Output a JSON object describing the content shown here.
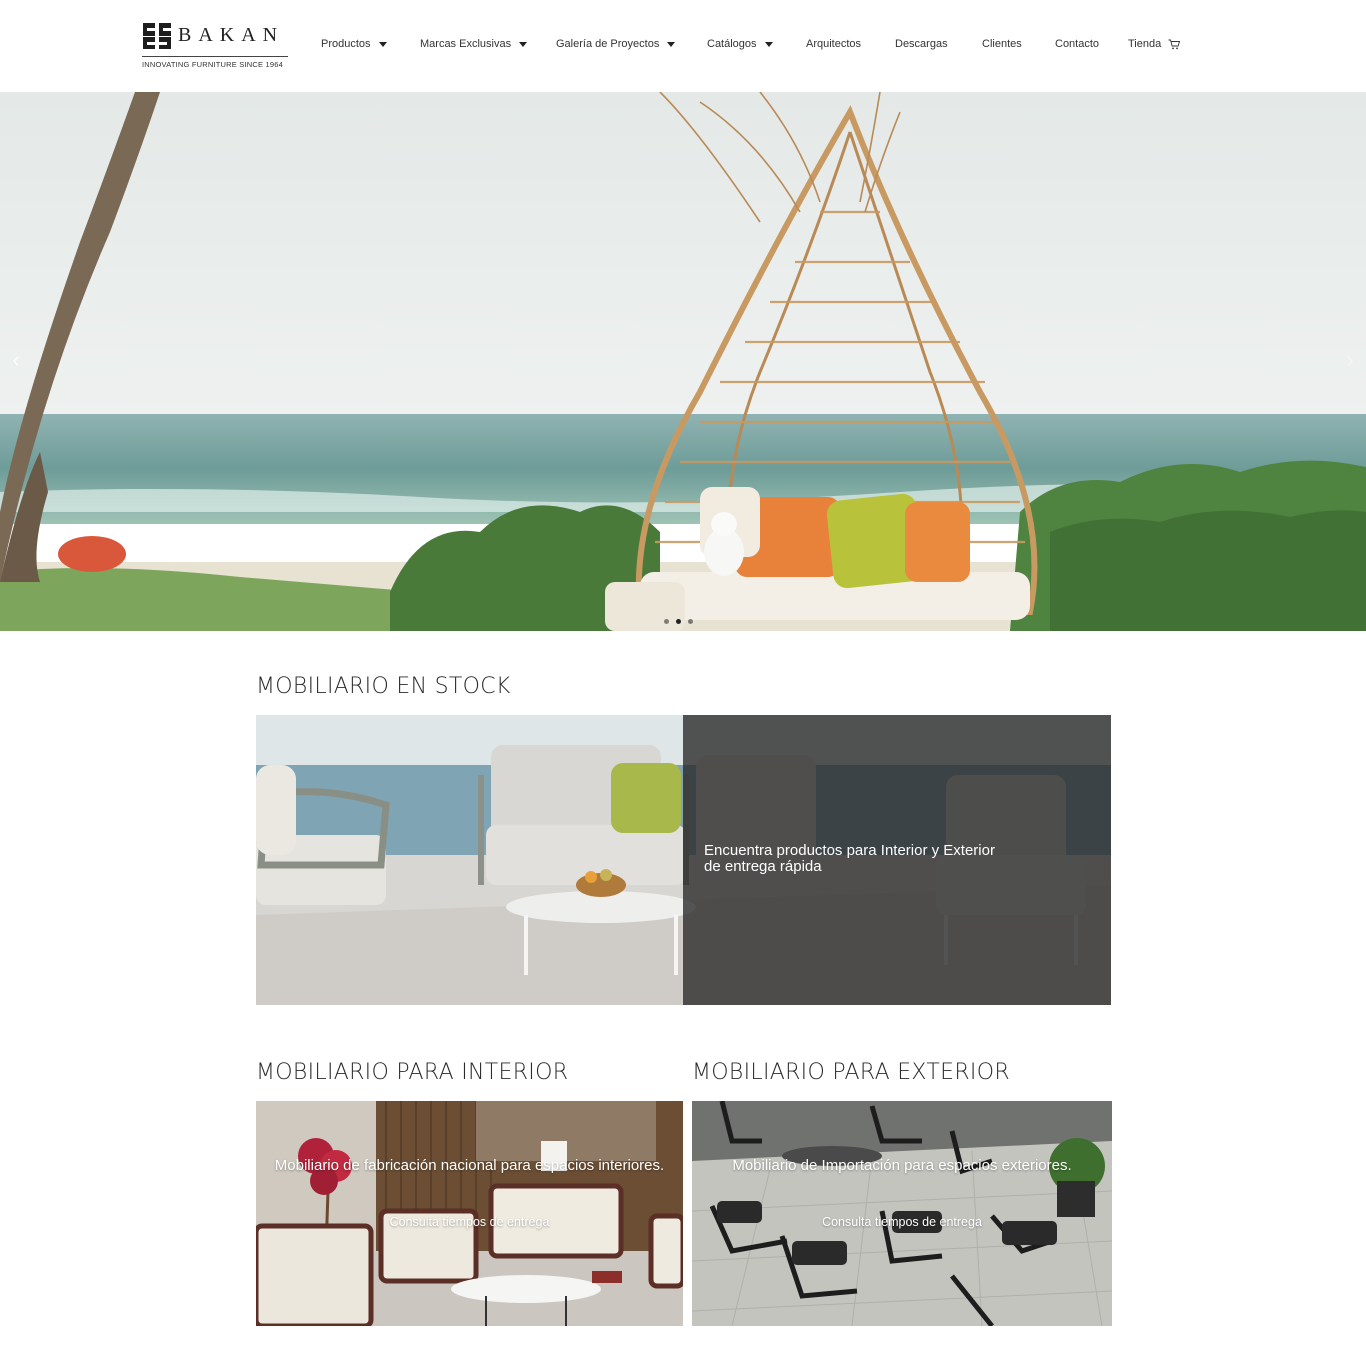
{
  "brand": {
    "name": "BAKAN",
    "tagline": "INNOVATING FURNITURE SINCE 1964"
  },
  "nav": {
    "items": [
      {
        "label": "Productos",
        "dropdown": true
      },
      {
        "label": "Marcas Exclusivas",
        "dropdown": true
      },
      {
        "label": "Galería de Proyectos",
        "dropdown": true
      },
      {
        "label": "Catálogos",
        "dropdown": true
      },
      {
        "label": "Arquitectos",
        "dropdown": false
      },
      {
        "label": "Descargas",
        "dropdown": false
      },
      {
        "label": "Clientes",
        "dropdown": false
      },
      {
        "label": "Contacto",
        "dropdown": false
      },
      {
        "label": "Tienda",
        "dropdown": false,
        "icon": "cart-icon"
      }
    ]
  },
  "hero": {
    "prev_icon": "chevron-left-icon",
    "next_icon": "chevron-right-icon",
    "prev_glyph": "‹",
    "next_glyph": "›",
    "slides_count": 3,
    "active_slide": 1
  },
  "stock": {
    "title": "MOBILIARIO EN STOCK",
    "text": "Encuentra productos para Interior y Exterior de entrega rápida"
  },
  "interior": {
    "title": "MOBILIARIO PARA INTERIOR",
    "text": "Mobiliario de fabricación nacional para espacios interiores.",
    "subtext": "Consulta tiempos de entrega"
  },
  "exterior": {
    "title": "MOBILIARIO PARA EXTERIOR",
    "text": "Mobiliario de Importación para espacios exteriores.",
    "subtext": "Consulta tiempos de entrega"
  },
  "colors": {
    "accent_orange": "#e8823a",
    "accent_green": "#b8c23a",
    "rattan": "#c89a62",
    "sea": "#6fa3a0",
    "sky": "#e9eeee"
  }
}
